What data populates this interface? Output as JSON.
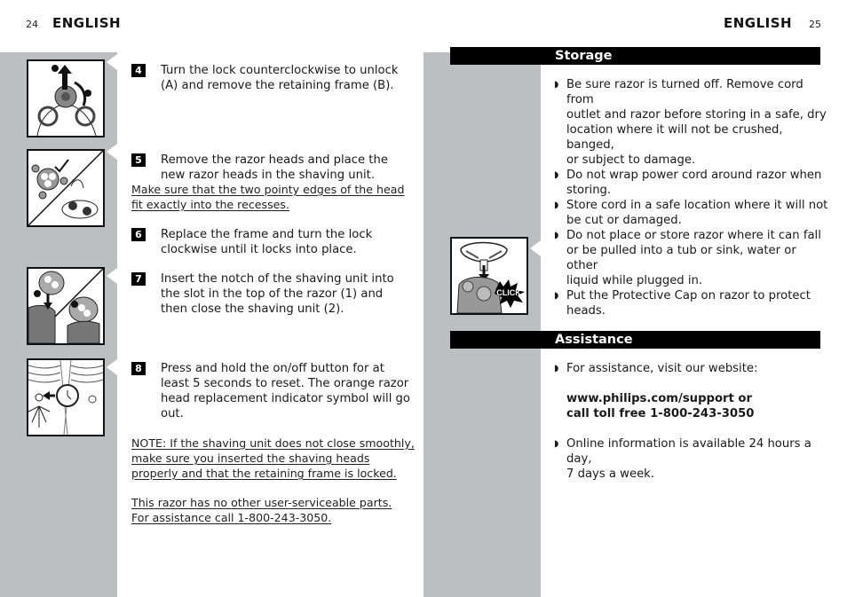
{
  "left_page": {
    "page_number": "24",
    "language": "ENGLISH",
    "steps": [
      {
        "number": "4",
        "text_lines": [
          "Turn the lock counterclockwise to unlock",
          "(A) and remove the retaining frame (B)."
        ],
        "illustration": "unlock-retaining-frame-illustration"
      },
      {
        "number": "5",
        "text_lines": [
          "Remove the razor heads and place the",
          "new razor heads in the shaving unit."
        ],
        "note_lines": [
          "Make sure that the two pointy edges of the head",
          "fit exactly into the recesses."
        ],
        "illustration": "replace-razor-heads-illustration"
      },
      {
        "number": "6",
        "text_lines": [
          "Replace the frame and turn the lock",
          "clockwise until it locks into place."
        ]
      },
      {
        "number": "7",
        "text_lines": [
          "Insert the notch of the shaving unit into",
          "the slot in the top of the razor (1) and",
          "then close the shaving unit (2)."
        ],
        "illustration": "insert-shaving-unit-illustration"
      },
      {
        "number": "8",
        "text_lines": [
          "Press and hold the on/off button for at",
          "least 5 seconds to reset. The orange razor",
          "head replacement indicator symbol will go",
          "out."
        ],
        "illustration": "reset-indicator-illustration"
      }
    ],
    "note_lines": [
      "NOTE: If the shaving unit does not close smoothly,",
      "make sure you inserted the shaving heads",
      "properly and that the retaining frame is locked."
    ],
    "service_lines": [
      "This razor has no other user-serviceable parts.",
      "For assistance call 1-800-243-3050."
    ]
  },
  "right_page": {
    "page_number": "25",
    "language": "ENGLISH",
    "storage": {
      "heading": "Storage",
      "bullets": [
        [
          "Be sure razor is turned off. Remove cord from",
          "outlet and razor before storing in a safe, dry",
          "location where it will not be crushed, banged,",
          "or subject to damage."
        ],
        [
          "Do not wrap power cord around razor when",
          "storing."
        ],
        [
          "Store cord in a safe location where it will not",
          "be cut or damaged."
        ],
        [
          "Do not place or store razor where it can fall",
          "or be pulled into a tub or sink, water or other",
          "liquid while plugged in."
        ],
        [
          "Put the Protective Cap on razor to protect",
          "heads."
        ]
      ],
      "illustration_label": "CLICK"
    },
    "assistance": {
      "heading": "Assistance",
      "bullet1": "For assistance, visit our website:",
      "contact_lines": [
        "www.philips.com/support or",
        "call toll free 1-800-243-3050"
      ],
      "bullet2_lines": [
        "Online information is available 24 hours a day,",
        "7 days a week."
      ]
    }
  },
  "colors": {
    "sidebar_grey": "#bdbebf",
    "bar_black": "#000000"
  }
}
